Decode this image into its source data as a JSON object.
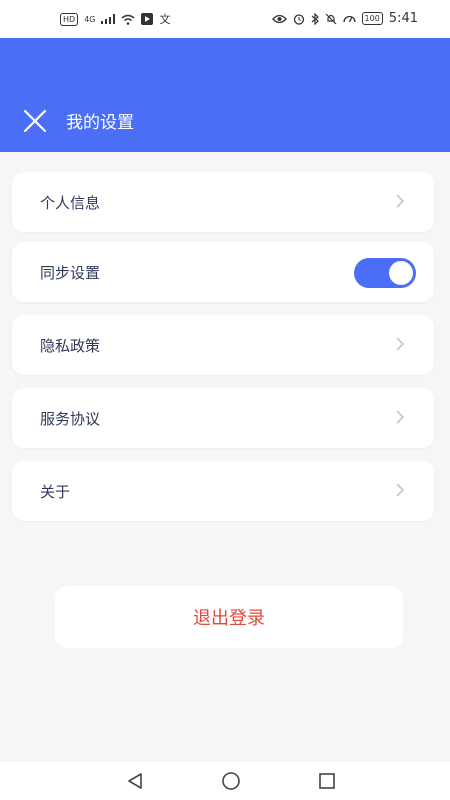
{
  "status_bar": {
    "left_badge": "HD",
    "signal": "4G",
    "time": "5:41",
    "battery": "100"
  },
  "header": {
    "title": "我的设置",
    "close_icon": "close-icon",
    "background_color": "#4a6ef5"
  },
  "settings": {
    "items": [
      {
        "label": "个人信息",
        "control": "chevron"
      },
      {
        "label": "同步设置",
        "control": "toggle",
        "toggle_on": true
      },
      {
        "label": "隐私政策",
        "control": "chevron"
      },
      {
        "label": "服务协议",
        "control": "chevron"
      },
      {
        "label": "关于",
        "control": "chevron"
      }
    ]
  },
  "logout": {
    "label": "退出登录",
    "color": "#e04a3a"
  },
  "nav": {
    "back_icon": "back-triangle-icon",
    "home_icon": "home-circle-icon",
    "recents_icon": "recents-square-icon"
  }
}
